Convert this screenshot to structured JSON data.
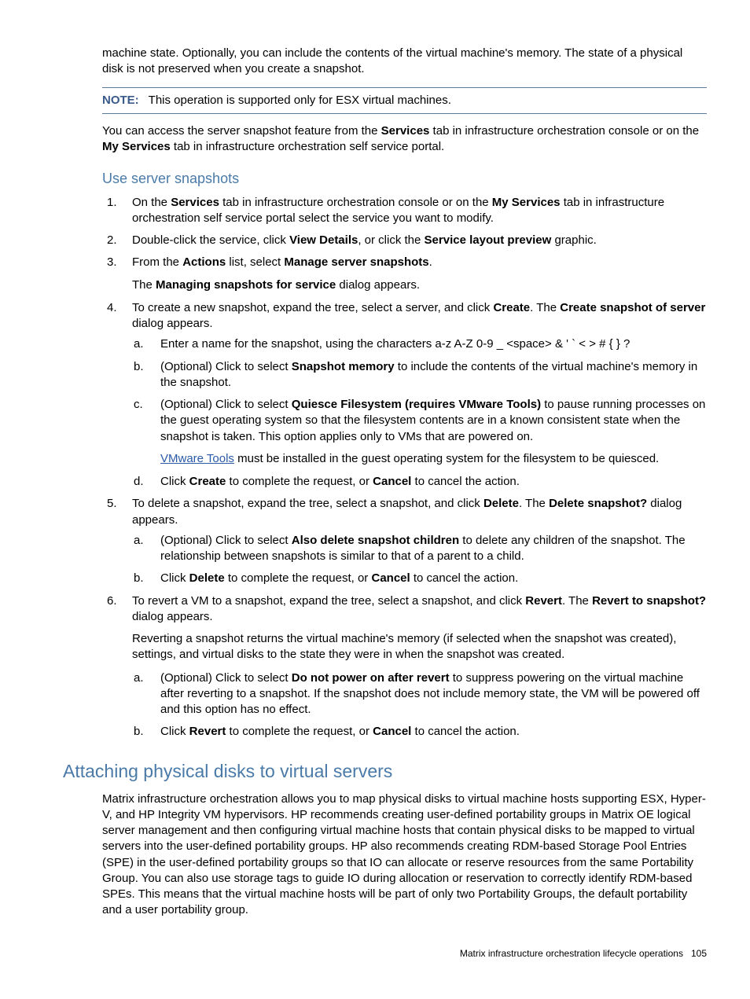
{
  "intro_para": {
    "pre": "machine state. Optionally, you can include the contents of the virtual machine's memory. The state of a physical disk is not preserved when you create a snapshot."
  },
  "note": {
    "label": "NOTE:",
    "text": "This operation is supported only for ESX virtual machines."
  },
  "access_para": {
    "t1": "You can access the server snapshot feature from the ",
    "b1": "Services",
    "t2": " tab in infrastructure orchestration console or on the ",
    "b2": "My Services",
    "t3": " tab in infrastructure orchestration self service portal."
  },
  "h3_1": "Use server snapshots",
  "li1": {
    "t1": "On the ",
    "b1": "Services",
    "t2": " tab in infrastructure orchestration console or on the ",
    "b2": "My Services",
    "t3": " tab in infrastructure orchestration self service portal select the service you want to modify."
  },
  "li2": {
    "t1": "Double-click the service, click ",
    "b1": "View Details",
    "t2": ", or click the ",
    "b2": "Service layout preview",
    "t3": " graphic."
  },
  "li3": {
    "t1": "From the ",
    "b1": "Actions",
    "t2": " list, select ",
    "b2": "Manage server snapshots",
    "t3": ".",
    "p2_t1": "The ",
    "p2_b1": "Managing snapshots for service",
    "p2_t2": " dialog appears."
  },
  "li4": {
    "t1": "To create a new snapshot, expand the tree, select a server, and click ",
    "b1": "Create",
    "t2": ". The ",
    "b2": "Create snapshot of server",
    "t3": " dialog appears.",
    "a": "Enter a name for the snapshot, using the characters a-z A-Z 0-9 _ <space> & ' ` < > # { } ?",
    "b_t1": "(Optional) Click to select ",
    "b_b1": "Snapshot memory",
    "b_t2": " to include the contents of the virtual machine's memory in the snapshot.",
    "c_t1": "(Optional) Click to select ",
    "c_b1": "Quiesce Filesystem (requires VMware Tools)",
    "c_t2": " to pause running processes on the guest operating system so that the filesystem contents are in a known consistent state when the snapshot is taken. This option applies only to VMs that are powered on.",
    "c_link": "VMware Tools",
    "c_p2": " must be installed in the guest operating system for the filesystem to be quiesced.",
    "d_t1": "Click ",
    "d_b1": "Create",
    "d_t2": " to complete the request, or ",
    "d_b2": "Cancel",
    "d_t3": " to cancel the action."
  },
  "li5": {
    "t1": "To delete a snapshot, expand the tree, select a snapshot, and click ",
    "b1": "Delete",
    "t2": ". The ",
    "b2": "Delete snapshot?",
    "t3": " dialog appears.",
    "a_t1": "(Optional) Click to select ",
    "a_b1": "Also delete snapshot children",
    "a_t2": " to delete any children of the snapshot. The relationship between snapshots is similar to that of a parent to a child.",
    "b_t1": "Click ",
    "b_b1": "Delete",
    "b_t2": " to complete the request, or ",
    "b_b2": "Cancel",
    "b_t3": " to cancel the action."
  },
  "li6": {
    "t1": "To revert a VM to a snapshot, expand the tree, select a snapshot, and click ",
    "b1": "Revert",
    "t2": ". The ",
    "b2": "Revert to snapshot?",
    "t3": " dialog appears.",
    "p2": "Reverting a snapshot returns the virtual machine's memory (if selected when the snapshot was created), settings, and virtual disks to the state they were in when the snapshot was created.",
    "a_t1": "(Optional) Click to select ",
    "a_b1": "Do not power on after revert",
    "a_t2": " to suppress powering on the virtual machine after reverting to a snapshot. If the snapshot does not include memory state, the VM will be powered off and this option has no effect.",
    "b_t1": "Click ",
    "b_b1": "Revert",
    "b_t2": " to complete the request, or ",
    "b_b2": "Cancel",
    "b_t3": " to cancel the action."
  },
  "h2_1": "Attaching physical disks to virtual servers",
  "attach_para": "Matrix infrastructure orchestration allows you to map physical disks to virtual machine hosts supporting ESX, Hyper-V, and HP Integrity VM hypervisors. HP recommends creating user-defined portability groups in Matrix OE logical server management and then configuring virtual machine hosts that contain physical disks to be mapped to virtual servers into the user-defined portability groups. HP also recommends creating RDM-based Storage Pool Entries (SPE) in the user-defined portability groups so that IO can allocate or reserve resources from the same Portability Group. You can also use storage tags to guide IO during allocation or reservation to correctly identify RDM-based SPEs. This means that the virtual machine hosts will be part of only two Portability Groups, the default portability and a user portability group.",
  "footer": {
    "text": "Matrix infrastructure orchestration lifecycle operations",
    "page": "105"
  }
}
